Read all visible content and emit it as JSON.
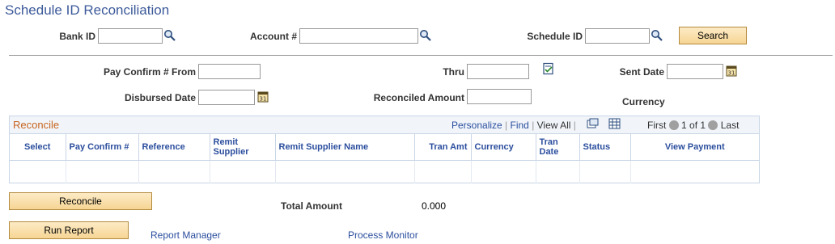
{
  "page": {
    "title": "Schedule ID Reconciliation"
  },
  "search": {
    "bank_id_label": "Bank ID",
    "bank_id_value": "",
    "account_label": "Account #",
    "account_value": "",
    "schedule_id_label": "Schedule ID",
    "schedule_id_value": "",
    "search_button": "Search"
  },
  "filters": {
    "pay_confirm_from_label": "Pay Confirm # From",
    "pay_confirm_from_value": "",
    "thru_label": "Thru",
    "thru_value": "",
    "sent_date_label": "Sent Date",
    "sent_date_value": "",
    "disbursed_date_label": "Disbursed Date",
    "disbursed_date_value": "",
    "reconciled_amount_label": "Reconciled Amount",
    "reconciled_amount_value": "",
    "currency_label": "Currency"
  },
  "grid": {
    "title": "Reconcile",
    "personalize": "Personalize",
    "find": "Find",
    "view_all": "View All",
    "first": "First",
    "page_info": "1 of 1",
    "last": "Last",
    "columns": [
      "Select",
      "Pay Confirm #",
      "Reference",
      "Remit Supplier",
      "Remit Supplier Name",
      "Tran Amt",
      "Currency",
      "Tran Date",
      "Status",
      "View Payment"
    ]
  },
  "actions": {
    "reconcile_button": "Reconcile",
    "total_amount_label": "Total Amount",
    "total_amount_value": "0.000",
    "run_report_button": "Run Report",
    "report_manager_link": "Report Manager",
    "process_monitor_link": "Process Monitor"
  },
  "colors": {
    "title": "#3c5a9a",
    "link": "#2b4e9e",
    "grid_title": "#c8641e",
    "button_bg": "#f6d594"
  },
  "icons": [
    "lookup-icon",
    "calendar-icon",
    "detail-icon",
    "zoom-icon",
    "download-icon",
    "prev-icon",
    "next-icon"
  ]
}
